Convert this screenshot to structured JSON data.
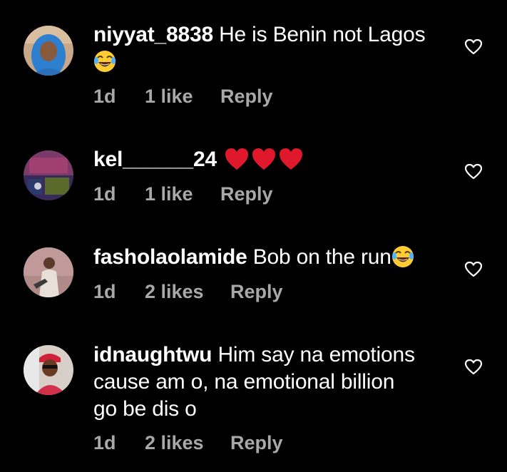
{
  "comments": [
    {
      "username": "niyyat_8838",
      "text": "He is Benin not Lagos",
      "emoji": "laughing-tears",
      "time": "1d",
      "likes": "1 like",
      "reply": "Reply",
      "avatar": "avatar-blue-hijab"
    },
    {
      "username": "kel______24",
      "text": "",
      "emoji": "red-hearts-x3",
      "time": "1d",
      "likes": "1 like",
      "reply": "Reply",
      "avatar": "avatar-poster"
    },
    {
      "username": "fasholaolamide",
      "text": "Bob on the run",
      "emoji": "laughing-tears",
      "time": "1d",
      "likes": "2 likes",
      "reply": "Reply",
      "avatar": "avatar-man-pink-wall"
    },
    {
      "username": "idnaughtwu",
      "text_lines": [
        "Him say na emotions",
        "cause am o, na emotional billion",
        "go be dis o"
      ],
      "time": "1d",
      "likes": "2 likes",
      "reply": "Reply",
      "avatar": "avatar-man-red-cap"
    }
  ],
  "colors": {
    "background": "#000000",
    "text": "#ffffff",
    "meta": "#a8a8a8",
    "heart_outline": "#ffffff",
    "red_heart": "#e0182b"
  },
  "icons": {
    "like": "heart-outline-icon",
    "laugh": "face-with-tears-of-joy-emoji",
    "love": "red-heart-emoji"
  }
}
